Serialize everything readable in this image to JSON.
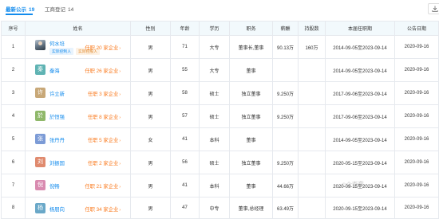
{
  "tabs": [
    {
      "label": "最新公示",
      "count": "19",
      "active": true
    },
    {
      "label": "工商登记",
      "count": "14",
      "active": false
    }
  ],
  "table": {
    "headers": [
      "序号",
      "姓名",
      "性别",
      "年龄",
      "学历",
      "职务",
      "薪酬",
      "持股数",
      "本届任职期",
      "公告日期"
    ],
    "rows": [
      {
        "index": "1",
        "name": "何水培",
        "avatar_char": "",
        "avatar_color": "",
        "photo": true,
        "tags": [
          "实际控制人",
          "实际控股人"
        ],
        "tenure": "任职 20 家企业",
        "gender": "男",
        "age": "71",
        "education": "大专",
        "position": "董事长,董事",
        "salary": "90.13万",
        "shares": "160万",
        "term": "2014-09-05至2023-09-14",
        "announce": "2020-09-16"
      },
      {
        "index": "2",
        "name": "秦海",
        "avatar_char": "秦",
        "avatar_color": "#5fb3b3",
        "photo": false,
        "tags": [],
        "tenure": "任职 26 家企业",
        "gender": "男",
        "age": "55",
        "education": "大专",
        "position": "董事",
        "salary": "",
        "shares": "",
        "term": "2014-09-05至2023-09-14",
        "announce": "2020-09-16"
      },
      {
        "index": "3",
        "name": "许立新",
        "avatar_char": "许",
        "avatar_color": "#c8a878",
        "photo": false,
        "tags": [],
        "tenure": "任职 3 家企业",
        "gender": "男",
        "age": "58",
        "education": "硕士",
        "position": "独立董事",
        "salary": "9.250万",
        "shares": "",
        "term": "2017-09-06至2023-09-14",
        "announce": "2020-09-16"
      },
      {
        "index": "4",
        "name": "於恒强",
        "avatar_char": "於",
        "avatar_color": "#8fb86a",
        "photo": false,
        "tags": [],
        "tenure": "任职 8 家企业",
        "gender": "男",
        "age": "57",
        "education": "硕士",
        "position": "独立董事",
        "salary": "9.250万",
        "shares": "",
        "term": "2017-09-06至2023-09-14",
        "announce": "2020-09-16"
      },
      {
        "index": "5",
        "name": "张丹丹",
        "avatar_char": "张",
        "avatar_color": "#7c9bd6",
        "photo": false,
        "tags": [],
        "tenure": "任职 5 家企业",
        "gender": "女",
        "age": "41",
        "education": "本科",
        "position": "董事",
        "salary": "",
        "shares": "",
        "term": "2014-09-05至2023-09-14",
        "announce": "2020-09-16"
      },
      {
        "index": "6",
        "name": "刘振国",
        "avatar_char": "刘",
        "avatar_color": "#e08a6e",
        "photo": false,
        "tags": [],
        "tenure": "任职 2 家企业",
        "gender": "男",
        "age": "56",
        "education": "硕士",
        "position": "独立董事",
        "salary": "9.250万",
        "shares": "",
        "term": "2020-05-15至2023-09-14",
        "announce": "2020-09-16"
      },
      {
        "index": "7",
        "name": "倪畅",
        "avatar_char": "倪",
        "avatar_color": "#d98bb0",
        "photo": false,
        "tags": [],
        "tenure": "任职 21 家企业",
        "gender": "男",
        "age": "41",
        "education": "本科",
        "position": "董事",
        "salary": "44.66万",
        "shares": "",
        "term": "2020-09-15至2023-09-14",
        "announce": "2020-09-16"
      },
      {
        "index": "8",
        "name": "杨朋向",
        "avatar_char": "杨",
        "avatar_color": "#6aa8c8",
        "photo": false,
        "tags": [],
        "tenure": "任职 34 家企业",
        "gender": "男",
        "age": "47",
        "education": "中专",
        "position": "董事,总经理",
        "salary": "63.49万",
        "shares": "",
        "term": "2020-09-15至2023-09-14",
        "announce": "2020-09-16"
      }
    ]
  },
  "watermark": "©企查查"
}
